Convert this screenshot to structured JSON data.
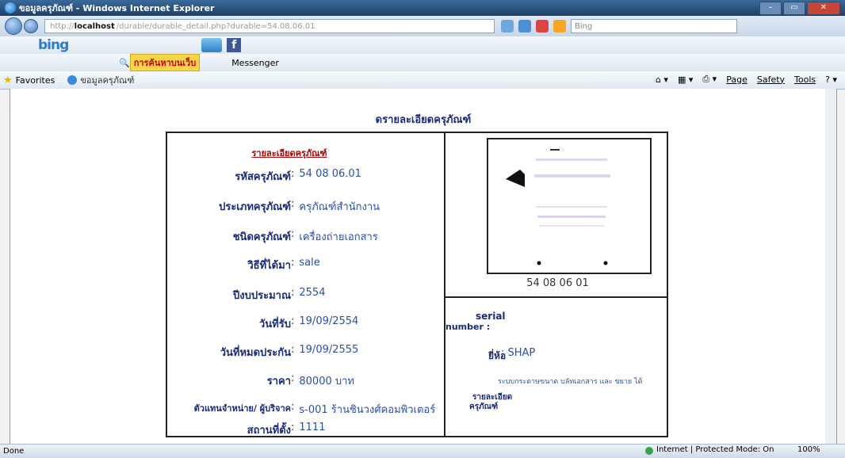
{
  "window": {
    "title": "ขอมูลครุภัณฑ์ - Windows Internet Explorer"
  },
  "address": {
    "protocol": "http://",
    "host": "localhost",
    "path": "/durable/durable_detail.php?durable=54.08.06.01",
    "search_placeholder": "Bing"
  },
  "bing_toolbar": {
    "logo": "bing",
    "fb_label": "f"
  },
  "toolbar2": {
    "search_button": "การค้นหาบนเว็บ",
    "messenger": "Messenger",
    "item3": "",
    "item4": "",
    "item5": ""
  },
  "favorites": {
    "label": "Favorites",
    "tab_title": "ขอมูลครุภัณฑ์"
  },
  "command_bar": {
    "page": "Page",
    "safety": "Safety",
    "tools": "Tools"
  },
  "page": {
    "title": "ดรายละเอียดครุภัณฑ์",
    "section_heading": "รายละเอียดครุภัณฑ์",
    "fields": [
      {
        "label": "รหัสครุภัณฑ์",
        "value": "54 08 06.01"
      },
      {
        "label": "ประเภทครุภัณฑ์",
        "value": "ครุภัณฑ์สำนักงาน"
      },
      {
        "label": "ชนิดครุภัณฑ์",
        "value": "เครื่องถ่ายเอกสาร"
      },
      {
        "label": "วิธีที่ได้มา",
        "value": "sale"
      },
      {
        "label": "ปีงบประมาณ",
        "value": "2554"
      },
      {
        "label": "วันที่รับ",
        "value": "19/09/2554"
      },
      {
        "label": "วันที่หมดประกัน",
        "value": "19/09/2555"
      },
      {
        "label": "ราคา",
        "value": "80000 บาท"
      },
      {
        "label": "ตัวแทนจำหน่าย/ ผู้บริจาค",
        "value": "s-001 ร้านชินวงศ์คอมพิวเตอร์"
      },
      {
        "label": "สถานที่ตั้ง",
        "value": "1111"
      }
    ],
    "image_caption": "54 08 06 01",
    "serial_label_1": "serial",
    "serial_label_2": "number :",
    "brand_label": "ยี่ห้อ",
    "brand_value": "SHAP",
    "desc_value": "ระบบกระดาษขนาด บลัทเอกสาร และ ขยาย ได้",
    "desc_label_1": "รายละเอียด",
    "desc_label_2": "ครุภัณฑ์"
  },
  "status": {
    "left": "Done",
    "zone": "Internet | Protected Mode: On",
    "zoom": "100%"
  },
  "colors": {
    "label_blue": "#1a2a7a",
    "value_blue": "#2a4fa8",
    "heading_red": "#b00000"
  }
}
